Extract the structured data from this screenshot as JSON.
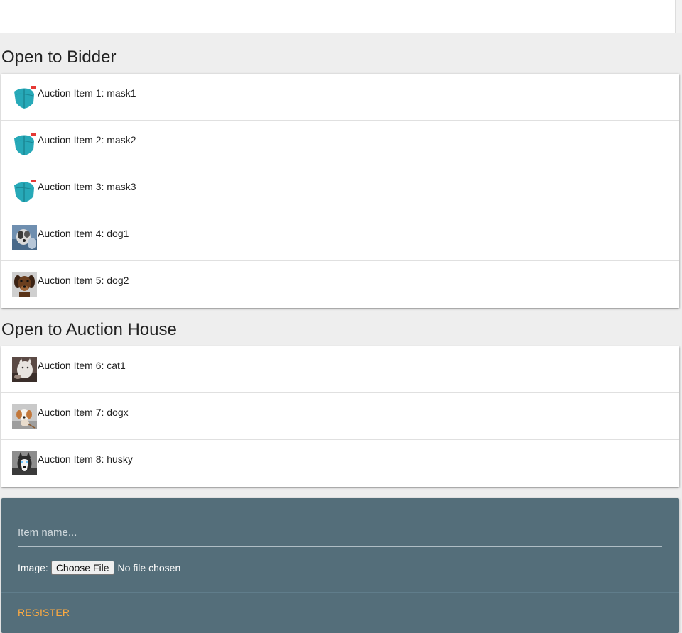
{
  "sections": {
    "bidder_title": "Open to Bidder",
    "house_title": "Open to Auction House"
  },
  "bidder_items": [
    {
      "label": "Auction Item 1: mask1",
      "icon": "mask-image-icon"
    },
    {
      "label": "Auction Item 2: mask2",
      "icon": "mask-image-icon"
    },
    {
      "label": "Auction Item 3: mask3",
      "icon": "mask-image-icon"
    },
    {
      "label": "Auction Item 4: dog1",
      "icon": "dog-photo-icon"
    },
    {
      "label": "Auction Item 5: dog2",
      "icon": "dog-photo-icon"
    }
  ],
  "house_items": [
    {
      "label": "Auction Item 6: cat1",
      "icon": "cat-photo-icon"
    },
    {
      "label": "Auction Item 7: dogx",
      "icon": "dog-photo-icon"
    },
    {
      "label": "Auction Item 8: husky",
      "icon": "husky-photo-icon"
    }
  ],
  "form": {
    "item_name_placeholder": "Item name...",
    "item_name_value": "",
    "image_label": "Image:",
    "choose_file_label": "Choose File",
    "file_status": "No file chosen",
    "register_label": "REGISTER"
  },
  "colors": {
    "form_background": "#546e7a",
    "register_accent": "#ffab40",
    "page_background": "#eeeeee"
  }
}
